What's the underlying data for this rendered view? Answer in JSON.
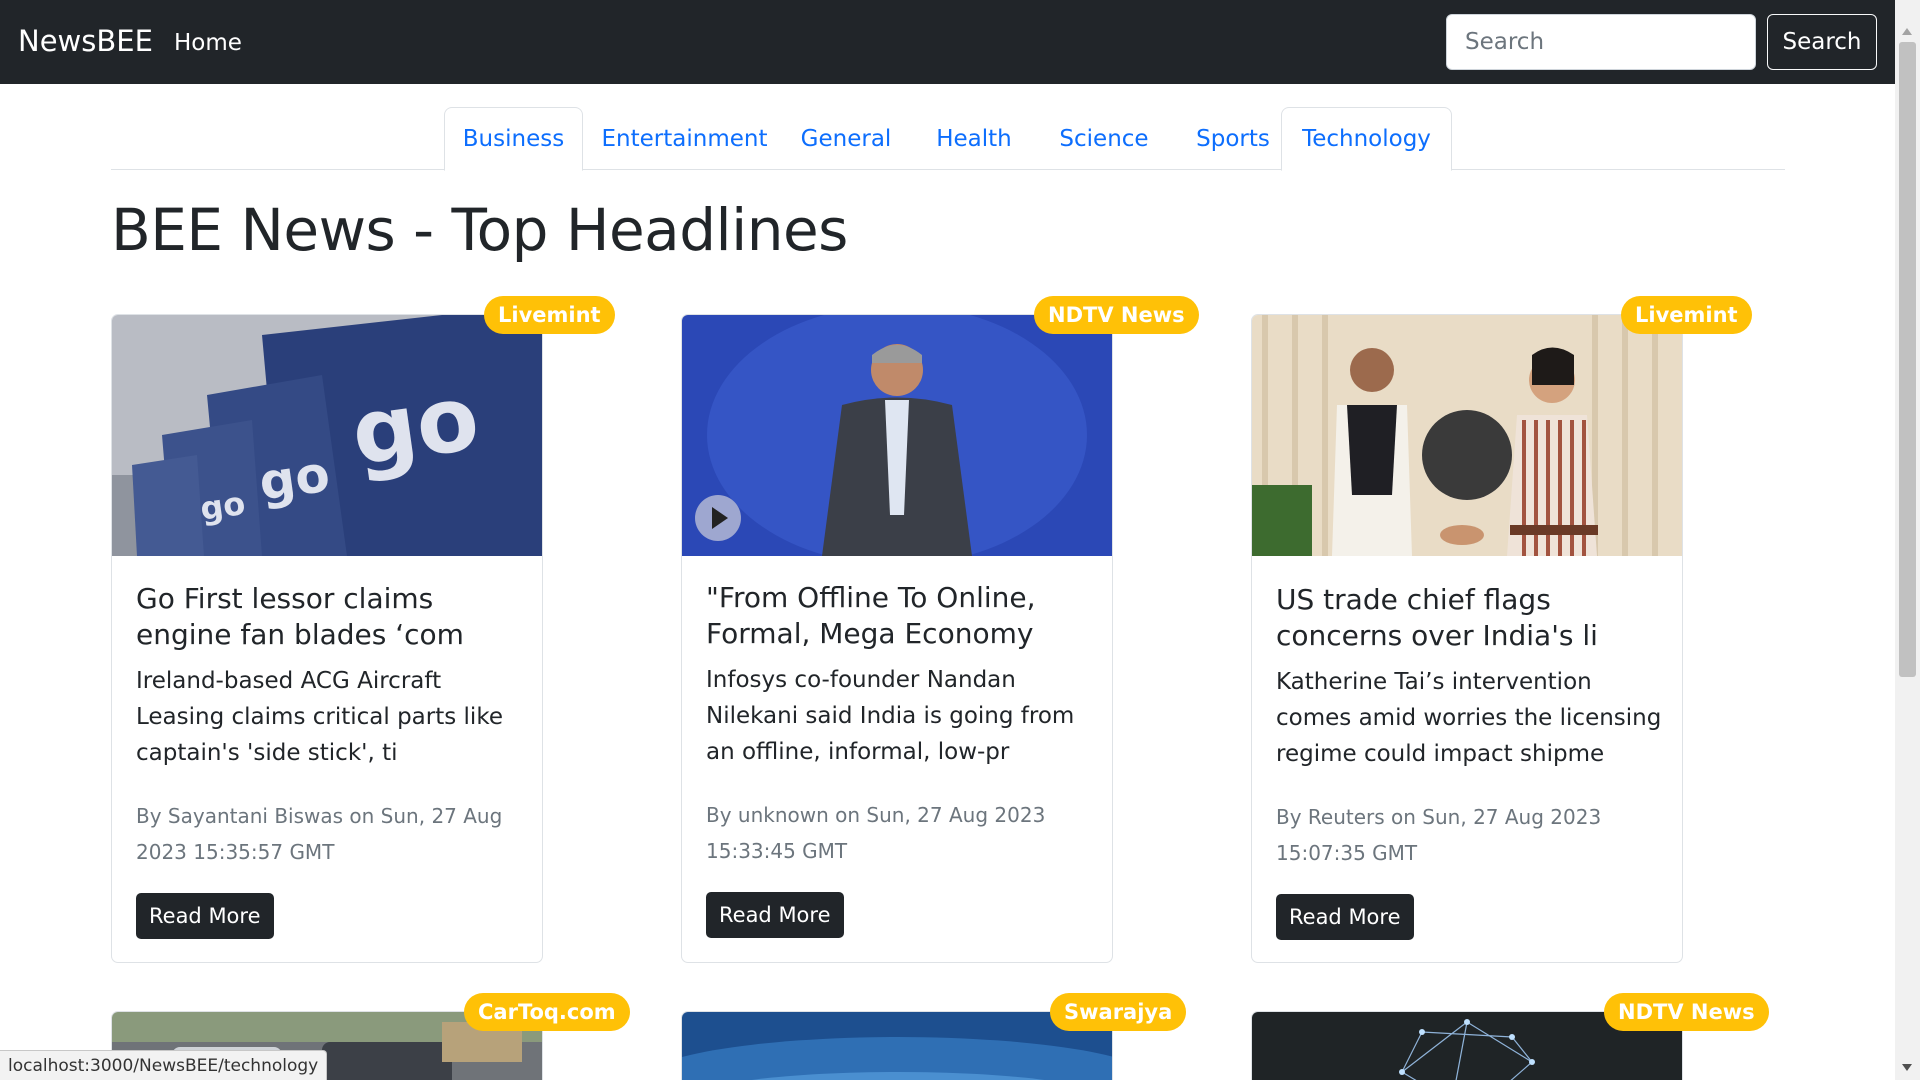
{
  "navbar": {
    "brand": "NewsBEE",
    "home_label": "Home",
    "search_placeholder": "Search",
    "search_button_label": "Search"
  },
  "tabs": [
    {
      "label": "Business"
    },
    {
      "label": "Entertainment"
    },
    {
      "label": "General"
    },
    {
      "label": "Health"
    },
    {
      "label": "Science"
    },
    {
      "label": "Sports"
    },
    {
      "label": "Technology"
    }
  ],
  "page_title": "BEE News - Top Headlines",
  "articles": [
    {
      "source": "Livemint",
      "title": "Go First lessor claims engine fan blades ‘com",
      "description": "Ireland-based ACG Aircraft Leasing claims critical parts like captain's 'side stick', ti",
      "meta": "By Sayantani Biswas on Sun, 27 Aug 2023 15:35:57 GMT",
      "button_label": "Read More"
    },
    {
      "source": "NDTV News",
      "title": "\"From Offline To Online, Formal, Mega Economy",
      "description": "Infosys co-founder Nandan Nilekani said India is going from an offline, informal, low-pr",
      "meta": "By unknown on Sun, 27 Aug 2023 15:33:45 GMT",
      "button_label": "Read More"
    },
    {
      "source": "Livemint",
      "title": "US trade chief flags concerns over India's li",
      "description": "Katherine Tai’s intervention comes amid worries the licensing regime could impact shipme",
      "meta": "By Reuters on Sun, 27 Aug 2023 15:07:35 GMT",
      "button_label": "Read More"
    }
  ],
  "next_row_sources": [
    "CarToq.com",
    "Swarajya",
    "NDTV News"
  ],
  "status_url": "localhost:3000/NewsBEE/technology",
  "colors": {
    "navbar": "#212529",
    "badge": "#ffc107",
    "link": "#0d6efd",
    "button": "#212529"
  }
}
